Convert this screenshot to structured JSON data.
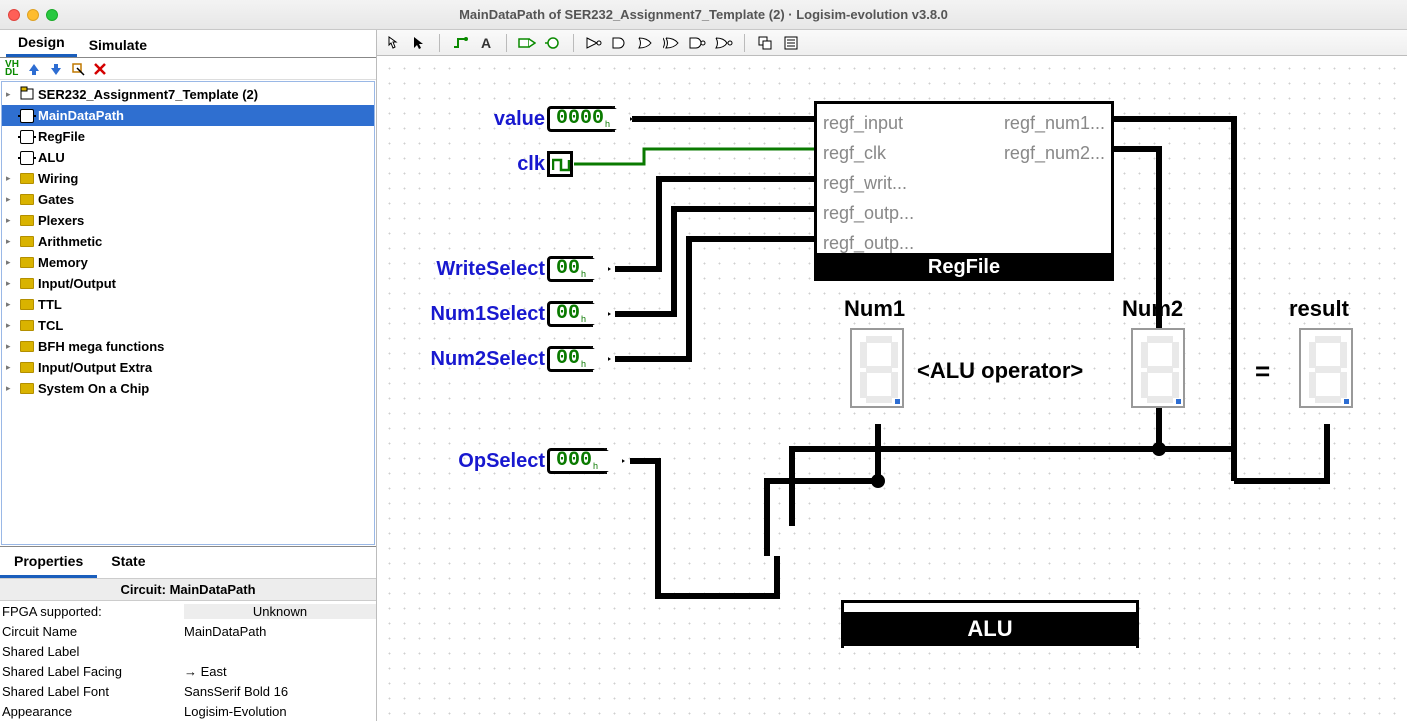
{
  "window": {
    "title": "MainDataPath of SER232_Assignment7_Template (2) · Logisim-evolution v3.8.0"
  },
  "tabs": {
    "design": "Design",
    "simulate": "Simulate"
  },
  "explorer": {
    "project": "SER232_Assignment7_Template (2)",
    "circuits": [
      "MainDataPath",
      "RegFile",
      "ALU"
    ],
    "libs": [
      "Wiring",
      "Gates",
      "Plexers",
      "Arithmetic",
      "Memory",
      "Input/Output",
      "TTL",
      "TCL",
      "BFH mega functions",
      "Input/Output Extra",
      "System On a Chip"
    ]
  },
  "proptabs": {
    "properties": "Properties",
    "state": "State"
  },
  "propheader": "Circuit: MainDataPath",
  "props": [
    {
      "k": "FPGA supported:",
      "v": "Unknown",
      "shade": true
    },
    {
      "k": "Circuit Name",
      "v": "MainDataPath"
    },
    {
      "k": "Shared Label",
      "v": ""
    },
    {
      "k": "Shared Label Facing",
      "v": "→ East"
    },
    {
      "k": "Shared Label Font",
      "v": "SansSerif Bold 16"
    },
    {
      "k": "Appearance",
      "v": "Logisim-Evolution"
    }
  ],
  "toolbar": {
    "poke": "poke",
    "select": "select",
    "wire": "wire",
    "text": "A",
    "inpin": "in",
    "outpin": "out",
    "not": "not",
    "and": "and",
    "or": "or",
    "xor": "xor",
    "nand": "nand",
    "nor": "nor",
    "dup": "dup",
    "menu": "menu"
  },
  "pins": {
    "value": {
      "label": "value",
      "val": "0000",
      "sub": "h"
    },
    "clk": {
      "label": "clk"
    },
    "writeSelect": {
      "label": "WriteSelect",
      "val": "00",
      "sub": "h"
    },
    "num1Select": {
      "label": "Num1Select",
      "val": "00",
      "sub": "h"
    },
    "num2Select": {
      "label": "Num2Select",
      "val": "00",
      "sub": "h"
    },
    "opSelect": {
      "label": "OpSelect",
      "val": "000",
      "sub": "h"
    }
  },
  "regfile": {
    "left": [
      "regf_input",
      "regf_clk",
      "regf_writ...",
      "regf_outp...",
      "regf_outp..."
    ],
    "right": [
      "regf_num1...",
      "regf_num2..."
    ],
    "name": "RegFile"
  },
  "displays": {
    "num1": "Num1",
    "num2": "Num2",
    "result": "result",
    "between": "<ALU operator>",
    "eq": "="
  },
  "alu": {
    "name": "ALU"
  }
}
